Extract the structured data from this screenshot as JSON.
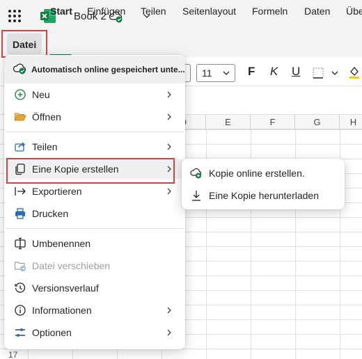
{
  "app": {
    "book_title": "Book 2"
  },
  "tabs": {
    "file": "Datei",
    "home": "Start",
    "insert": "Einfügen",
    "share": "Teilen",
    "page_layout": "Seitenlayout",
    "formulas": "Formeln",
    "data": "Daten",
    "review_partial": "Übe"
  },
  "toolbar": {
    "font_size": "11",
    "bold_glyph": "F",
    "italic_glyph": "K",
    "underline_glyph": "U"
  },
  "grid": {
    "columns": [
      "D",
      "E",
      "F",
      "G",
      "H"
    ],
    "row_partial": "17"
  },
  "file_menu": {
    "autosave_status": "Automatisch online gespeichert unte...",
    "items": [
      {
        "label": "Neu",
        "icon": "plus-circle-icon",
        "submenu": true
      },
      {
        "label": "Öffnen",
        "icon": "folder-open-icon",
        "submenu": true
      },
      {
        "label": "Teilen",
        "icon": "share-icon",
        "submenu": true
      },
      {
        "label": "Eine Kopie erstellen",
        "icon": "copy-icon",
        "submenu": true
      },
      {
        "label": "Exportieren",
        "icon": "export-arrow-icon",
        "submenu": true
      },
      {
        "label": "Drucken",
        "icon": "printer-icon",
        "submenu": false
      },
      {
        "label": "Umbenennen",
        "icon": "rename-icon",
        "submenu": false
      },
      {
        "label": "Datei verschieben",
        "icon": "move-folder-icon",
        "submenu": false,
        "disabled": true
      },
      {
        "label": "Versionsverlauf",
        "icon": "history-icon",
        "submenu": false
      },
      {
        "label": "Informationen",
        "icon": "info-icon",
        "submenu": true
      },
      {
        "label": "Optionen",
        "icon": "options-sliders-icon",
        "submenu": true
      }
    ]
  },
  "copy_submenu": {
    "items": [
      {
        "label": "Kopie online erstellen.",
        "icon": "cloud-add-icon"
      },
      {
        "label": "Eine Kopie herunterladen",
        "icon": "download-icon"
      }
    ]
  },
  "colors": {
    "accent_green": "#107c41",
    "highlight_red": "#d9413f",
    "folder_orange": "#e8a33d",
    "print_blue": "#2b6cb0"
  }
}
